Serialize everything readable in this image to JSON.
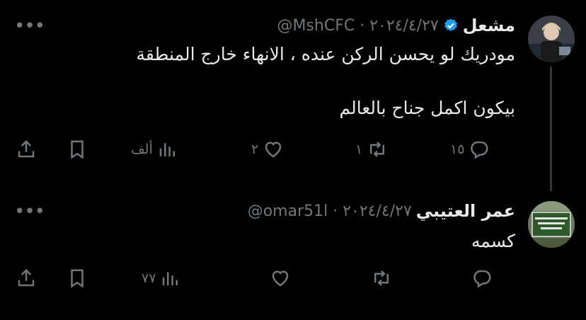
{
  "tweets": [
    {
      "display_name": "مشعل",
      "meta": "@MshCFC · ٢٠٢٤/٤/٢٧",
      "text": "مودريك لو يحسن الركن عنده ، الانهاء خارج المنطقة\n\nبيكون اكمل جناح بالعالم",
      "counts": {
        "replies": "١٥",
        "retweets": "١",
        "likes": "٢",
        "views": "ألف"
      }
    },
    {
      "display_name": "عمر العتيبي",
      "meta": "@omar51l · ٢٠٢٤/٤/٢٧",
      "text": "كسمه",
      "avatar_text": "أولى الناس بي يوم القيامة أكثرهم علي صلاة",
      "counts": {
        "replies": "",
        "retweets": "",
        "likes": "",
        "views": "٧٧"
      }
    }
  ],
  "more_label": "•••",
  "colors": {
    "background": "#000000",
    "text": "#e7e9ea",
    "muted": "#71767b",
    "verified": "#1d9bf0"
  }
}
